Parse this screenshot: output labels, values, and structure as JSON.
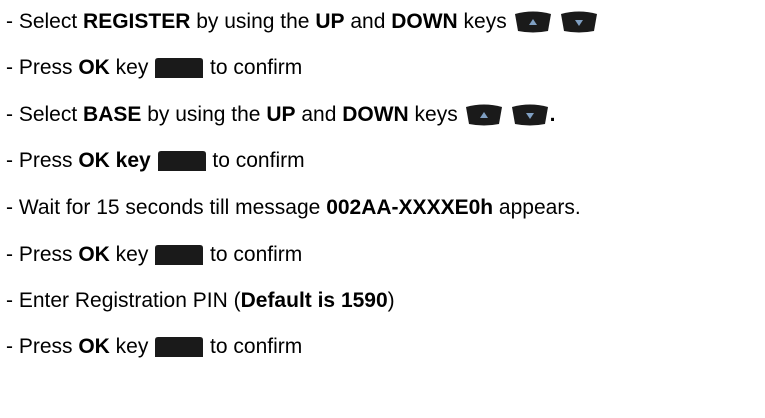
{
  "steps": [
    {
      "parts": [
        "- Select ",
        "REGISTER",
        " by using the ",
        "UP",
        " and ",
        "DOWN",
        " keys "
      ],
      "icons": [
        "up-key",
        "down-key"
      ],
      "suffix": ""
    },
    {
      "parts": [
        "- Press ",
        "OK",
        " key ",
        " to confirm"
      ],
      "icons": [
        "ok-key"
      ]
    },
    {
      "parts": [
        "- Select ",
        "BASE",
        " by using the ",
        "UP",
        " and ",
        "DOWN",
        " keys "
      ],
      "icons": [
        "up-key",
        "down-key"
      ],
      "suffix": "."
    },
    {
      "parts": [
        "- Press ",
        "OK key",
        " ",
        " to confirm"
      ],
      "icons": [
        "ok-key"
      ]
    },
    {
      "parts": [
        "- Wait for 15 seconds till message ",
        "002AA-XXXXE0h",
        " appears."
      ]
    },
    {
      "parts": [
        "- Press ",
        "OK",
        " key ",
        " to confirm"
      ],
      "icons": [
        "ok-key"
      ]
    },
    {
      "parts": [
        "- Enter Registration PIN (",
        "Default is 1590",
        ")"
      ]
    },
    {
      "parts": [
        "- Press ",
        "OK",
        " key ",
        " to confirm"
      ],
      "icons": [
        "ok-key"
      ]
    }
  ],
  "icon_colors": {
    "key_body": "#1a1a1a",
    "key_arrow": "#7f9fc2"
  }
}
